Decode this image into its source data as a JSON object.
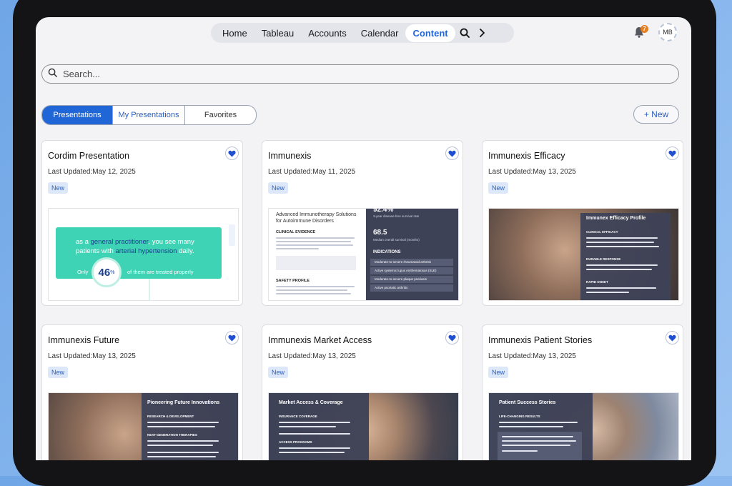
{
  "nav": {
    "items": [
      {
        "label": "Home"
      },
      {
        "label": "Tableau"
      },
      {
        "label": "Accounts"
      },
      {
        "label": "Calendar"
      },
      {
        "label": "Content"
      }
    ],
    "active": "Content",
    "notification_count": "7",
    "avatar_initials": "MB"
  },
  "search": {
    "placeholder": "Search..."
  },
  "segmented": {
    "options": [
      {
        "label": "Presentations"
      },
      {
        "label": "My Presentations"
      },
      {
        "label": "Favorites"
      }
    ],
    "selected": "Presentations"
  },
  "new_button": {
    "label": "+ New"
  },
  "colors": {
    "accent": "#2166d6",
    "badge_bg": "#dce8f9",
    "teal": "#3fd3b5",
    "dark_panel": "#3e4257"
  },
  "cards": [
    {
      "title": "Cordim Presentation",
      "updated": "Last Updated:May 12, 2025",
      "badge": "New",
      "thumb": {
        "line1a": "as a ",
        "line1b": "general practitioner",
        "line1c": ", you see many",
        "line2a": "patients with ",
        "line2b": "arterial hypertension",
        "line2c": " daily.",
        "only": "Only",
        "pct": "46",
        "pct_sign": "%",
        "treated": "of them are treated properly"
      }
    },
    {
      "title": "Immunexis",
      "updated": "Last Updated:May 11, 2025",
      "badge": "New",
      "thumb": {
        "heading": "Advanced Immunotherapy Solutions for Autoimmune Disorders",
        "clinical": "CLINICAL EVIDENCE",
        "safety": "SAFETY PROFILE",
        "stat1": "92.4%",
        "stat1_label": "3-year disease-free survival rate",
        "stat2": "68.5",
        "stat2_label": "Median overall survival (months)",
        "indications": "INDICATIONS",
        "ind": [
          "Moderate-to-severe rheumatoid arthritis",
          "Active systemic lupus erythematosus (SLE)",
          "Moderate-to-severe plaque psoriasis",
          "Active psoriatic arthritis"
        ]
      }
    },
    {
      "title": "Immunexis Efficacy",
      "updated": "Last Updated:May 13, 2025",
      "badge": "New",
      "thumb": {
        "panel_title": "Immunex Efficacy Profile",
        "h1": "CLINICAL EFFICACY",
        "h2": "DURABLE RESPONSE",
        "h3": "RAPID ONSET"
      }
    },
    {
      "title": "Immunexis Future",
      "updated": "Last Updated:May 13, 2025",
      "badge": "New",
      "thumb": {
        "panel_title": "Pioneering Future Innovations",
        "h1": "RESEARCH & DEVELOPMENT",
        "h2": "NEXT-GENERATION THERAPIES"
      }
    },
    {
      "title": "Immunexis Market Access",
      "updated": "Last Updated:May 13, 2025",
      "badge": "New",
      "thumb": {
        "panel_title": "Market Access & Coverage",
        "h1": "INSURANCE COVERAGE",
        "h2": "ACCESS PROGRAMS"
      }
    },
    {
      "title": "Immunexis Patient Stories",
      "updated": "Last Updated:May 13, 2025",
      "badge": "New",
      "thumb": {
        "panel_title": "Patient Success Stories",
        "h1": "LIFE-CHANGING RESULTS"
      }
    }
  ]
}
